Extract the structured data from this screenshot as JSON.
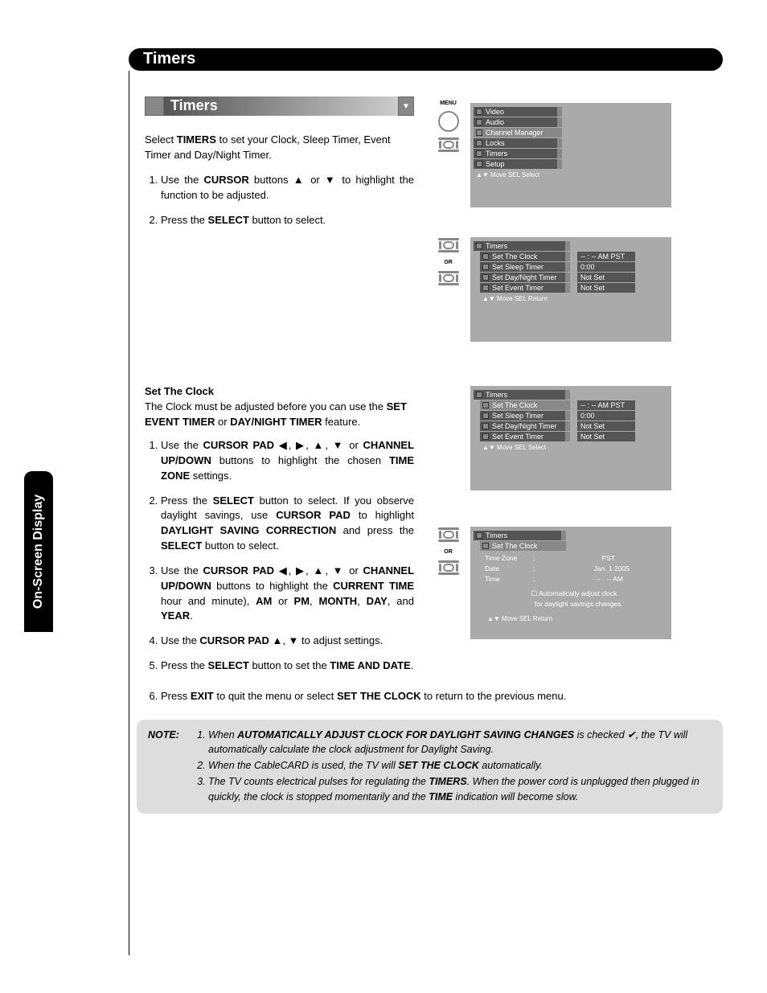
{
  "header": {
    "title": "Timers"
  },
  "side_tab": "On-Screen Display",
  "section_bar": {
    "title": "Timers"
  },
  "intro": {
    "p1a": "Select ",
    "p1b": "TIMERS",
    "p1c": " to set your Clock, Sleep Timer, Event Timer and Day/Night Timer."
  },
  "steps_a": [
    {
      "pre": "Use the ",
      "b": "CURSOR",
      "post": " buttons ▲ or ▼ to highlight the function to be adjusted."
    },
    {
      "pre": "Press the ",
      "b": "SELECT",
      "post": " button to select."
    }
  ],
  "set_clock": {
    "heading": "Set The Clock",
    "intro_a": "The Clock must be adjusted before you can use the ",
    "intro_b": "SET EVENT TIMER",
    "intro_c": " or ",
    "intro_d": "DAY/NIGHT TIMER",
    "intro_e": " feature."
  },
  "steps_b": {
    "s1": "Use the <b>CURSOR PAD</b> ◀, ▶, ▲, ▼ or <b>CHANNEL UP/DOWN</b> buttons to highlight the chosen <b>TIME ZONE</b> settings.",
    "s2": "Press the <b>SELECT</b> button to select. If you observe daylight savings, use <b>CURSOR PAD</b> to highlight <b>DAYLIGHT SAVING CORRECTION</b> and press the <b>SELECT</b> button to select.",
    "s3": "Use the <b>CURSOR PAD</b> ◀, ▶, ▲, ▼ or <b>CHANNEL UP/DOWN</b> buttons to highlight the <b>CURRENT TIME</b> hour and minute), <b>AM</b> or <b>PM</b>, <b>MONTH</b>, <b>DAY</b>, and <b>YEAR</b>.",
    "s4": "Use the <b>CURSOR PAD</b> ▲, ▼ to adjust settings.",
    "s5": "Press the <b>SELECT</b> button to set the <b>TIME AND DATE</b>.",
    "s6": "Press <b>EXIT</b> to quit the menu or select <b>SET THE CLOCK</b> to return to the previous menu."
  },
  "note": {
    "lead": "NOTE:",
    "n1": "When <b>AUTOMATICALLY ADJUST CLOCK FOR DAYLIGHT SAVING CHANGES</b> is checked ✔, the TV will automatically calculate the clock adjustment for Daylight Saving.",
    "n2": "When the CableCARD is used, the TV will <b>SET THE CLOCK</b> automatically.",
    "n3": "The TV counts electrical pulses for regulating the <b>TIMERS</b>. When the power cord is unplugged then plugged in quickly, the clock is stopped momentarily and the <b>TIME</b> indication will become slow."
  },
  "osd1": {
    "items": [
      "Video",
      "Audio",
      "Channel Manager",
      "Locks",
      "Timers",
      "Setup"
    ],
    "hint": "▲▼ Move    SEL Select"
  },
  "osd2": {
    "title": "Timers",
    "items": [
      "Set The Clock",
      "Set Sleep Timer",
      "Set Day/Night Timer",
      "Set Event Timer"
    ],
    "vals": [
      "-- : --  AM PST",
      "0:00",
      "Not Set",
      "Not Set"
    ],
    "hint": "▲▼ Move    SEL Return"
  },
  "osd3": {
    "title": "Timers",
    "items": [
      "Set The Clock",
      "Set Sleep Timer",
      "Set Day/Night Timer",
      "Set Event Timer"
    ],
    "vals": [
      "-- : --  AM PST",
      "0:00",
      "Not Set",
      "Not Set"
    ],
    "hint": "▲▼ Move    SEL Select"
  },
  "osd4": {
    "title": "Timers",
    "sub": "Set The Clock",
    "rows": [
      {
        "k": "Time Zone",
        "v": "PST"
      },
      {
        "k": "Date",
        "v": "Jan. 1 2005"
      },
      {
        "k": "Time",
        "v": "-- : --  AM"
      }
    ],
    "auto": "☐ Automatically adjust clock\n     for daylight savings changes.",
    "hint": "▲▼ Move    SEL Return"
  },
  "remote": {
    "menu": "MENU",
    "or": "OR"
  }
}
